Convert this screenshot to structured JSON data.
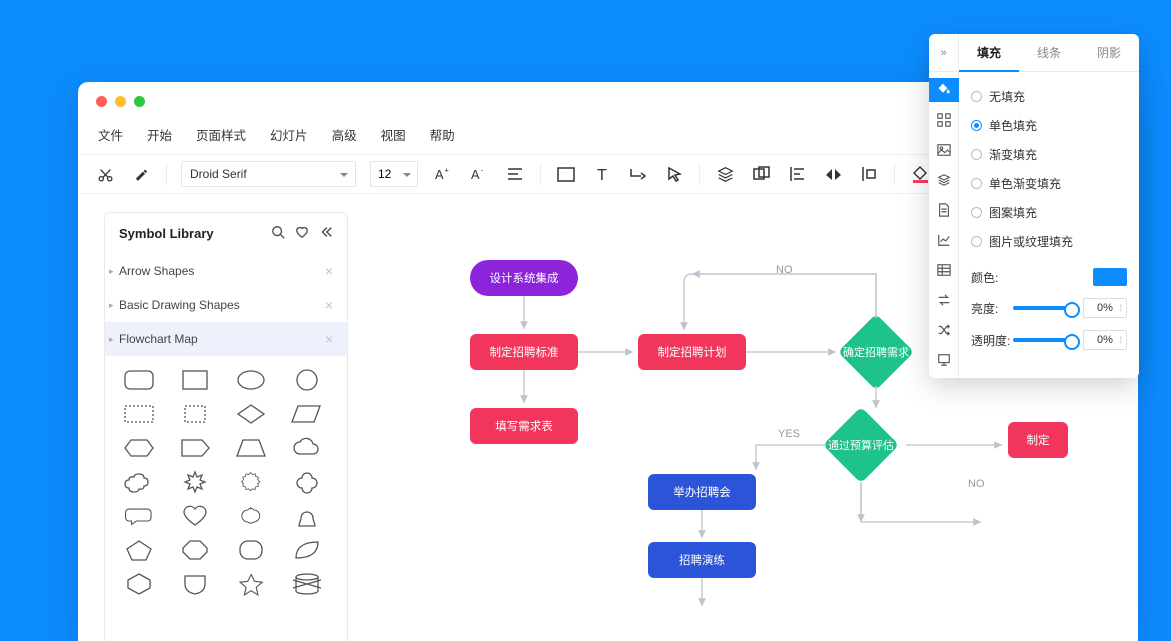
{
  "menu": {
    "file": "文件",
    "start": "开始",
    "page_style": "页面样式",
    "slides": "幻灯片",
    "advanced": "高级",
    "view": "视图",
    "help": "帮助"
  },
  "toolbar": {
    "font": "Droid Serif",
    "size": "12"
  },
  "shape_panel": {
    "title": "Symbol Library",
    "cat_arrow": "Arrow Shapes",
    "cat_basic": "Basic Drawing Shapes",
    "cat_flow": "Flowchart Map"
  },
  "flow": {
    "n1": "设计系统集成",
    "n2": "制定招聘标准",
    "n3": "制定招聘计划",
    "n4": "填写需求表",
    "n5": "确定招聘需求",
    "n6": "举办招聘会",
    "n7": "通过预算评估",
    "n8": "招聘演练",
    "n9": "制定",
    "no": "NO",
    "yes": "YES"
  },
  "props": {
    "tab_fill": "填充",
    "tab_line": "线条",
    "tab_shadow": "阴影",
    "f_none": "无填充",
    "f_solid": "单色填充",
    "f_grad": "渐变填充",
    "f_solid_grad": "单色渐变填充",
    "f_pattern": "图案填充",
    "f_image": "图片或纹理填充",
    "lbl_color": "颜色:",
    "lbl_bright": "亮度:",
    "lbl_opacity": "透明度:",
    "val_bright": "0%",
    "val_opacity": "0%"
  }
}
